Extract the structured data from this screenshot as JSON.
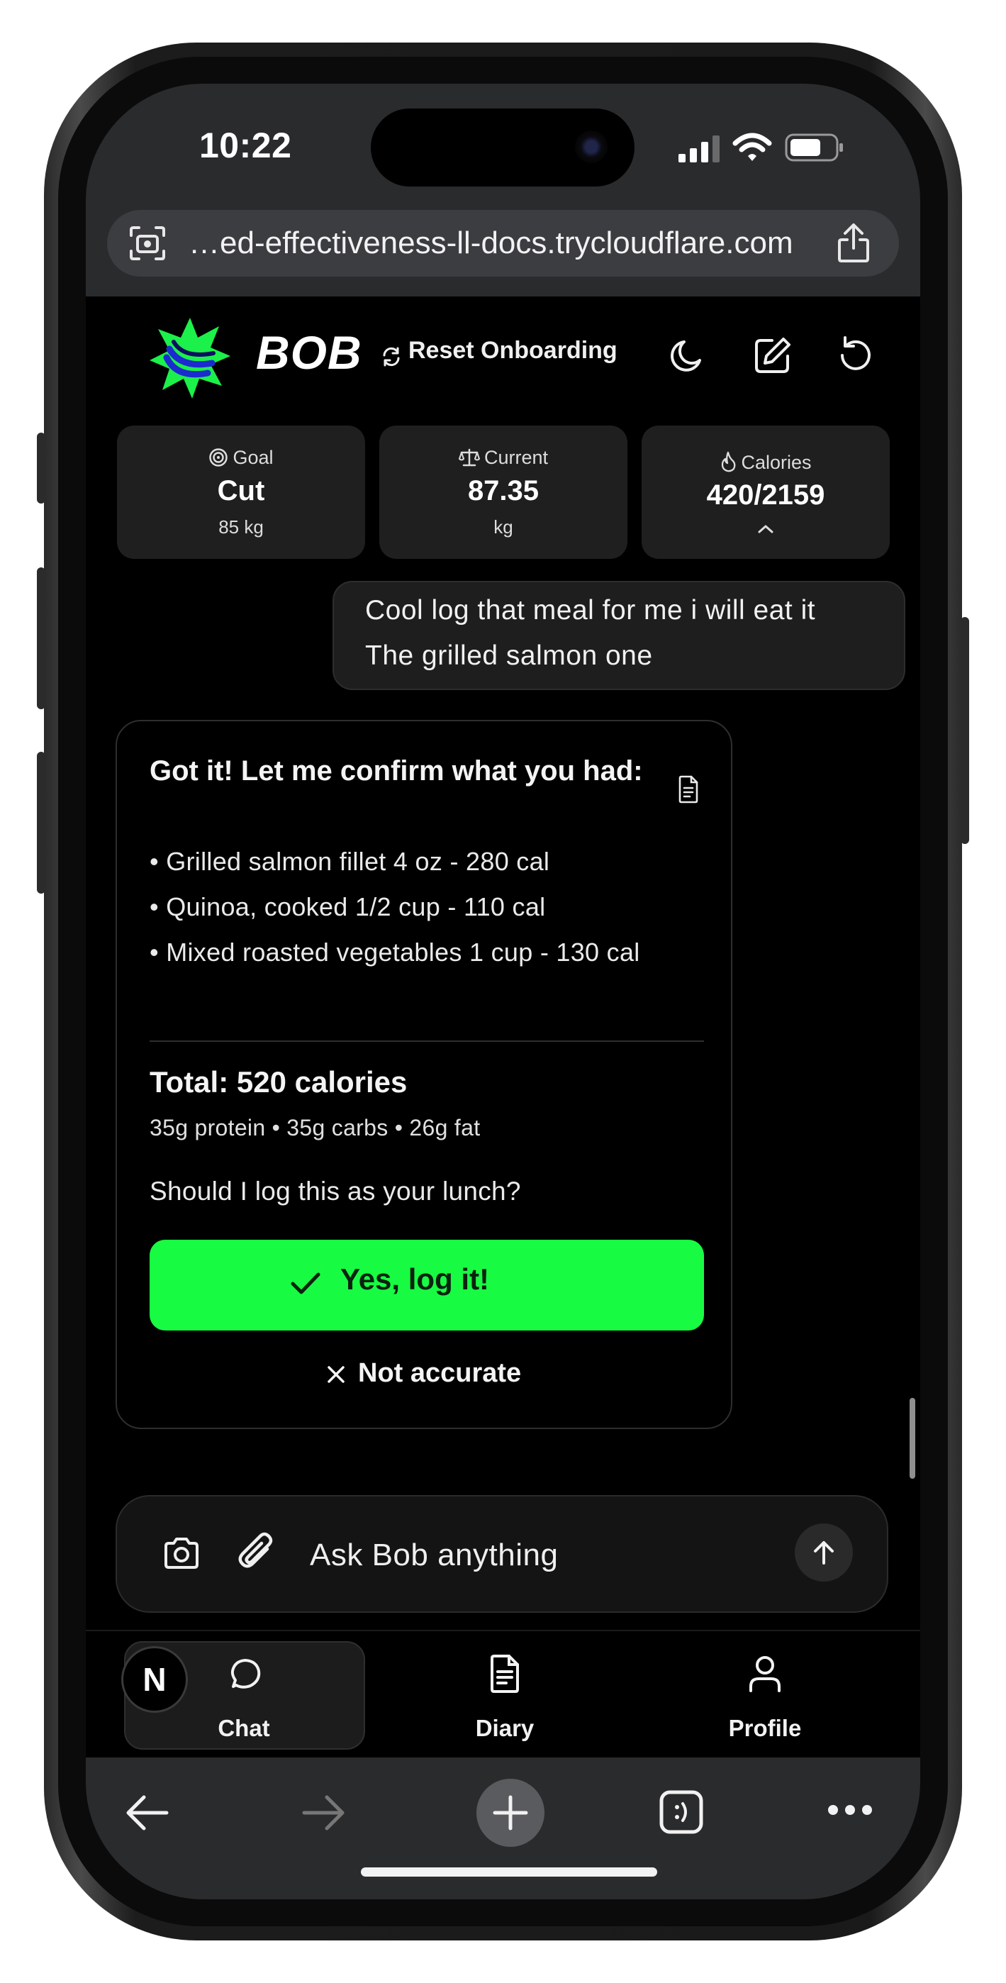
{
  "status_bar": {
    "time": "10:22"
  },
  "browser": {
    "url": "…ed-effectiveness-ll-docs.trycloudflare.com"
  },
  "header": {
    "brand": "BOB",
    "reset_label": "Reset Onboarding"
  },
  "stats": {
    "goal": {
      "label": "Goal",
      "value": "Cut",
      "sub": "85 kg"
    },
    "current": {
      "label": "Current",
      "value": "87.35",
      "sub": "kg"
    },
    "calories": {
      "label": "Calories",
      "value": "420/2159"
    }
  },
  "user_message": {
    "line1": "Cool log that meal for me i will eat it",
    "line2": "The grilled salmon one"
  },
  "bot_message": {
    "title": "Got it! Let me confirm what you had:",
    "items": [
      "• Grilled salmon fillet 4 oz - 280 cal",
      "• Quinoa, cooked 1/2 cup - 110 cal",
      "• Mixed roasted vegetables 1 cup - 130 cal"
    ],
    "total": "Total: 520 calories",
    "macros": "35g protein • 35g carbs • 26g fat",
    "question": "Should I log this as your lunch?",
    "confirm_label": "Yes, log it!",
    "reject_label": "Not accurate"
  },
  "input": {
    "placeholder": "Ask Bob anything"
  },
  "nav": {
    "items": [
      {
        "label": "Chat",
        "active": true
      },
      {
        "label": "Diary",
        "active": false
      },
      {
        "label": "Profile",
        "active": false
      }
    ],
    "avatar_initial": "N"
  },
  "colors": {
    "accent": "#18fb43",
    "background": "#000000",
    "card": "#1f1f20"
  },
  "icons": {
    "status": [
      "signal-icon",
      "wifi-icon",
      "battery-icon"
    ],
    "header": [
      "moon-icon",
      "edit-icon",
      "refresh-icon"
    ]
  }
}
